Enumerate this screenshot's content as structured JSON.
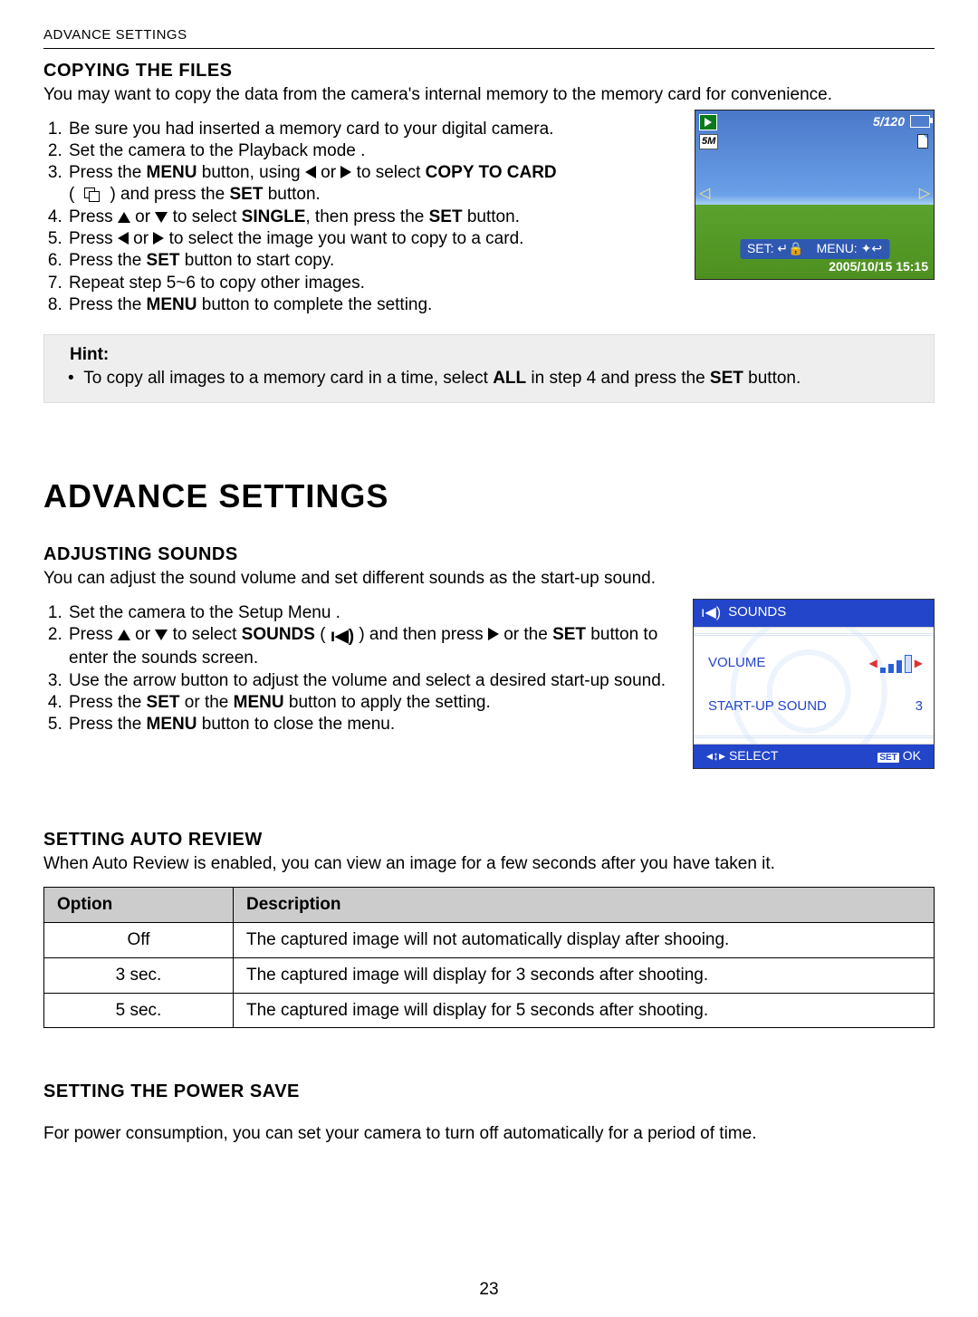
{
  "header": "ADVANCE SETTINGS",
  "page_number": "23",
  "copying": {
    "title": "COPYING THE FILES",
    "intro": "You may want to copy the data from the camera's internal memory to the memory card for convenience.",
    "steps": {
      "s1": "Be sure you had inserted a memory card to your digital camera.",
      "s2": "Set the camera to the Playback mode .",
      "s3a": "Press the ",
      "s3b": "MENU",
      "s3c": " button, using ",
      "s3d": " or ",
      "s3e": " to select ",
      "s3f": "COPY TO CARD",
      "s3g": " ) and press the ",
      "s3h": "SET",
      "s3i": " button.",
      "s4a": "Press ",
      "s4b": " or ",
      "s4c": " to select ",
      "s4d": "SINGLE",
      "s4e": ", then press the ",
      "s4f": "SET",
      "s4g": " button.",
      "s5a": "Press ",
      "s5b": " or ",
      "s5c": " to select the image you want to copy to a card.",
      "s6a": "Press the ",
      "s6b": "SET",
      "s6c": " button to start copy.",
      "s7": "Repeat step 5~6 to copy other images.",
      "s8a": "Press the ",
      "s8b": "MENU",
      "s8c": " button to complete the setting."
    },
    "hint_title": "Hint:",
    "hint_a": "To copy all images to a memory card in a time, select ",
    "hint_b": "ALL",
    "hint_c": " in step 4 and press the ",
    "hint_d": "SET",
    "hint_e": " button."
  },
  "cam1": {
    "counter": "5/120",
    "res": "5M",
    "set_label": "SET:",
    "menu_label": "MENU:",
    "datetime": "2005/10/15  15:15"
  },
  "chapter": "ADVANCE SETTINGS",
  "sounds": {
    "title": "ADJUSTING SOUNDS",
    "intro": "You can adjust the sound volume and set different sounds as the start-up sound.",
    "steps": {
      "s1": "Set the camera to the Setup Menu .",
      "s2a": "Press ",
      "s2b": " or ",
      "s2c": " to select ",
      "s2d": "SOUNDS",
      "s2e": " ) and then press ",
      "s2f": " or the ",
      "s2g": "SET",
      "s2h": " button to enter the sounds screen.",
      "s3": "Use the arrow button to adjust the volume and select a desired start-up sound.",
      "s4a": "Press the ",
      "s4b": "SET",
      "s4c": " or the ",
      "s4d": "MENU",
      "s4e": " button to apply the setting.",
      "s5a": "Press the ",
      "s5b": "MENU",
      "s5c": " button to close the menu."
    }
  },
  "cam2": {
    "title": "SOUNDS",
    "volume": "VOLUME",
    "startup": "START-UP SOUND",
    "startup_val": "3",
    "select": "SELECT",
    "ok": "OK",
    "set": "SET"
  },
  "autoreview": {
    "title": "SETTING AUTO REVIEW",
    "intro": "When Auto Review is enabled, you can view an image for a few seconds after you have taken it.",
    "th1": "Option",
    "th2": "Description",
    "rows": [
      {
        "opt": "Off",
        "desc": "The captured image will not automatically display after shooing."
      },
      {
        "opt": "3 sec.",
        "desc": "The captured image will display for 3 seconds after shooting."
      },
      {
        "opt": "5 sec.",
        "desc": "The captured image will display for 5 seconds after shooting."
      }
    ]
  },
  "powersave": {
    "title": "SETTING THE POWER SAVE",
    "intro": "For power consumption, you can set your camera to turn off automatically for a period of time."
  },
  "chart_data": {
    "type": "table",
    "title": "Auto Review options",
    "columns": [
      "Option",
      "Description"
    ],
    "rows": [
      [
        "Off",
        "The captured image will not automatically display after shooing."
      ],
      [
        "3 sec.",
        "The captured image will display for 3 seconds after shooting."
      ],
      [
        "5 sec.",
        "The captured image will display for 5 seconds after shooting."
      ]
    ]
  }
}
